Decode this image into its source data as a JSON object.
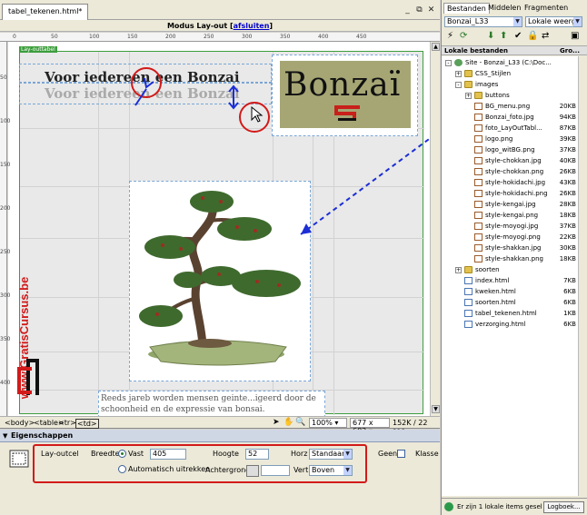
{
  "document": {
    "tab_title": "tabel_tekenen.html*",
    "mode_label": "Modus Lay-out",
    "mode_bracket_open": "[",
    "mode_link": "afsluiten",
    "mode_bracket_close": "]",
    "window_buttons": [
      "_",
      "⧉",
      "✕"
    ],
    "layout_table_label": "Lay-outtabel"
  },
  "ruler": {
    "h_ticks": [
      "0",
      "50",
      "100",
      "150",
      "200",
      "250",
      "300",
      "350",
      "400",
      "450"
    ],
    "v_ticks": [
      "50",
      "100",
      "150",
      "200",
      "250",
      "300",
      "350",
      "400"
    ]
  },
  "canvas": {
    "heading_dark": "Voor iedereen een Bonzai",
    "heading_light": "Voor iedereen een Bonzai",
    "logo_text": "Bonzaï",
    "side_brand": "www.GratisCursus.be",
    "paragraph_line1": "Reeds jareb worden mensen geinte...igeerd door de",
    "paragraph_line2": "schoonheid en de expressie van bonsai. Tegenwoordig is"
  },
  "statusbar": {
    "tags": [
      "<body>",
      "<table>",
      "<tr>",
      "<td>"
    ],
    "zoom": "100%",
    "dimensions": "677 x 602",
    "filesize": "152K / 22 sec"
  },
  "properties": {
    "title": "Eigenschappen",
    "element_label": "Lay-outcel",
    "breedte_label": "Breedte",
    "vast_label": "Vast",
    "width_value": "405",
    "auto_label": "Automatisch uitrekken",
    "hoogte_label": "Hoogte",
    "height_value": "52",
    "achtergrond_label": "Achtergrond",
    "horz_label": "Horz",
    "horz_value": "Standaar",
    "vert_label": "Vert",
    "vert_value": "Boven",
    "geen_label": "Geen",
    "klasse_label": "Klasse"
  },
  "files_panel": {
    "tabs": [
      "Bestanden",
      "Middelen",
      "Fragmenten"
    ],
    "site_select": "Bonzai_L33",
    "view_select": "Lokale weerg",
    "col_name": "Lokale bestanden",
    "col_size": "Gro...",
    "rows": [
      {
        "name": "Site - Bonzai_L33 (C:\\Doc...",
        "size": "",
        "type": "site",
        "level": 0,
        "expander": "-"
      },
      {
        "name": "CSS_Stijlen",
        "size": "",
        "type": "folder",
        "level": 1,
        "expander": "+"
      },
      {
        "name": "images",
        "size": "",
        "type": "folder",
        "level": 1,
        "expander": "-"
      },
      {
        "name": "buttons",
        "size": "",
        "type": "folder",
        "level": 2,
        "expander": "+"
      },
      {
        "name": "BG_menu.png",
        "size": "20KB",
        "type": "img",
        "level": 2,
        "expander": ""
      },
      {
        "name": "Bonzai_foto.jpg",
        "size": "94KB",
        "type": "img",
        "level": 2,
        "expander": ""
      },
      {
        "name": "foto_LayOutTabl...",
        "size": "87KB",
        "type": "img",
        "level": 2,
        "expander": ""
      },
      {
        "name": "logo.png",
        "size": "39KB",
        "type": "img",
        "level": 2,
        "expander": ""
      },
      {
        "name": "logo_witBG.png",
        "size": "37KB",
        "type": "img",
        "level": 2,
        "expander": ""
      },
      {
        "name": "style-chokkan.jpg",
        "size": "40KB",
        "type": "img",
        "level": 2,
        "expander": ""
      },
      {
        "name": "style-chokkan.png",
        "size": "26KB",
        "type": "img",
        "level": 2,
        "expander": ""
      },
      {
        "name": "style-hokidachi.jpg",
        "size": "43KB",
        "type": "img",
        "level": 2,
        "expander": ""
      },
      {
        "name": "style-hokidachi.png",
        "size": "26KB",
        "type": "img",
        "level": 2,
        "expander": ""
      },
      {
        "name": "style-kengai.jpg",
        "size": "28KB",
        "type": "img",
        "level": 2,
        "expander": ""
      },
      {
        "name": "style-kengai.png",
        "size": "18KB",
        "type": "img",
        "level": 2,
        "expander": ""
      },
      {
        "name": "style-moyogi.jpg",
        "size": "37KB",
        "type": "img",
        "level": 2,
        "expander": ""
      },
      {
        "name": "style-moyogi.png",
        "size": "22KB",
        "type": "img",
        "level": 2,
        "expander": ""
      },
      {
        "name": "style-shakkan.jpg",
        "size": "30KB",
        "type": "img",
        "level": 2,
        "expander": ""
      },
      {
        "name": "style-shakkan.png",
        "size": "18KB",
        "type": "img",
        "level": 2,
        "expander": ""
      },
      {
        "name": "soorten",
        "size": "",
        "type": "folder",
        "level": 1,
        "expander": "+"
      },
      {
        "name": "index.html",
        "size": "7KB",
        "type": "html",
        "level": 1,
        "expander": ""
      },
      {
        "name": "kweken.html",
        "size": "6KB",
        "type": "html",
        "level": 1,
        "expander": ""
      },
      {
        "name": "soorten.html",
        "size": "6KB",
        "type": "html",
        "level": 1,
        "expander": ""
      },
      {
        "name": "tabel_tekenen.html",
        "size": "1KB",
        "type": "html",
        "level": 1,
        "expander": ""
      },
      {
        "name": "verzorging.html",
        "size": "6KB",
        "type": "html",
        "level": 1,
        "expander": ""
      }
    ],
    "status_text": "Er zijn 1 lokale items gesel",
    "log_button": "Logboek..."
  },
  "colors": {
    "accent_red": "#d21a1a",
    "arrow_blue": "#1c2ed6",
    "layout_green": "#3c9e3c"
  }
}
